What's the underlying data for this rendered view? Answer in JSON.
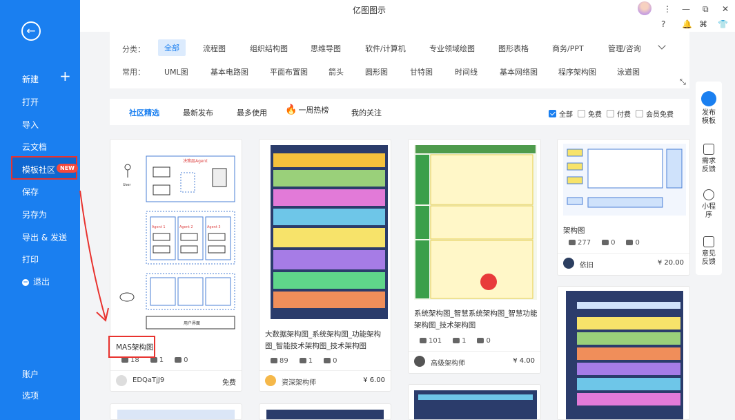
{
  "app": {
    "title": "亿图图示"
  },
  "window": {
    "min": "—",
    "restore": "⧉",
    "close": "✕"
  },
  "toolbar_icons": [
    "?",
    "🔔",
    "⌘",
    "👕"
  ],
  "sidebar": {
    "back": "←",
    "items": [
      {
        "label": "新建"
      },
      {
        "label": "打开"
      },
      {
        "label": "导入"
      },
      {
        "label": "云文档"
      },
      {
        "label": "模板社区",
        "badge": "NEW"
      },
      {
        "label": "保存"
      },
      {
        "label": "另存为"
      },
      {
        "label": "导出 & 发送"
      },
      {
        "label": "打印"
      },
      {
        "label": "退出"
      },
      {
        "label": "账户"
      },
      {
        "label": "选项"
      }
    ],
    "plus": "+"
  },
  "categories": {
    "label1": "分类：",
    "row1": [
      "全部",
      "流程图",
      "组织结构图",
      "思维导图",
      "软件/计算机",
      "专业领域绘图",
      "图形表格",
      "商务/PPT",
      "管理/咨询"
    ],
    "label2": "常用：",
    "row2": [
      "UML图",
      "基本电路图",
      "平面布置图",
      "箭头",
      "圆形图",
      "甘特图",
      "时间线",
      "基本网络图",
      "程序架构图",
      "泳道图"
    ]
  },
  "tabs": [
    "社区精选",
    "最新发布",
    "最多使用",
    "一周热榜",
    "我的关注"
  ],
  "filters": [
    {
      "label": "全部",
      "checked": true
    },
    {
      "label": "免费",
      "checked": false
    },
    {
      "label": "付费",
      "checked": false
    },
    {
      "label": "会员免费",
      "checked": false
    }
  ],
  "float_bar": [
    "发布模板",
    "需求反馈",
    "小程序",
    "意见反馈"
  ],
  "cards": [
    {
      "title": "MAS架构图",
      "views": "18",
      "copies": "1",
      "likes": "0",
      "author": "EDQaTjJ9",
      "price": "免费"
    },
    {
      "title": "大数据架构图_系统架构图_功能架构图_智能技术架构图_技术架构图",
      "views": "89",
      "copies": "1",
      "likes": "0",
      "author": "资深架构师",
      "price": "¥ 6.00"
    },
    {
      "title": "系统架构图_智慧系统架构图_智慧功能架构图_技术架构图",
      "views": "101",
      "copies": "1",
      "likes": "0",
      "author": "高级架构师",
      "price": "¥ 4.00"
    },
    {
      "title": "架构图",
      "views": "277",
      "copies": "0",
      "likes": "0",
      "author": "依旧",
      "price": "¥ 20.00"
    }
  ],
  "thumb_texts": {
    "agent_title": "决策层Agent",
    "user": "User",
    "agent1": "Agent 1",
    "agent2": "Agent 2",
    "agent3": "Agent 3",
    "ui_layer": "用户界面"
  }
}
